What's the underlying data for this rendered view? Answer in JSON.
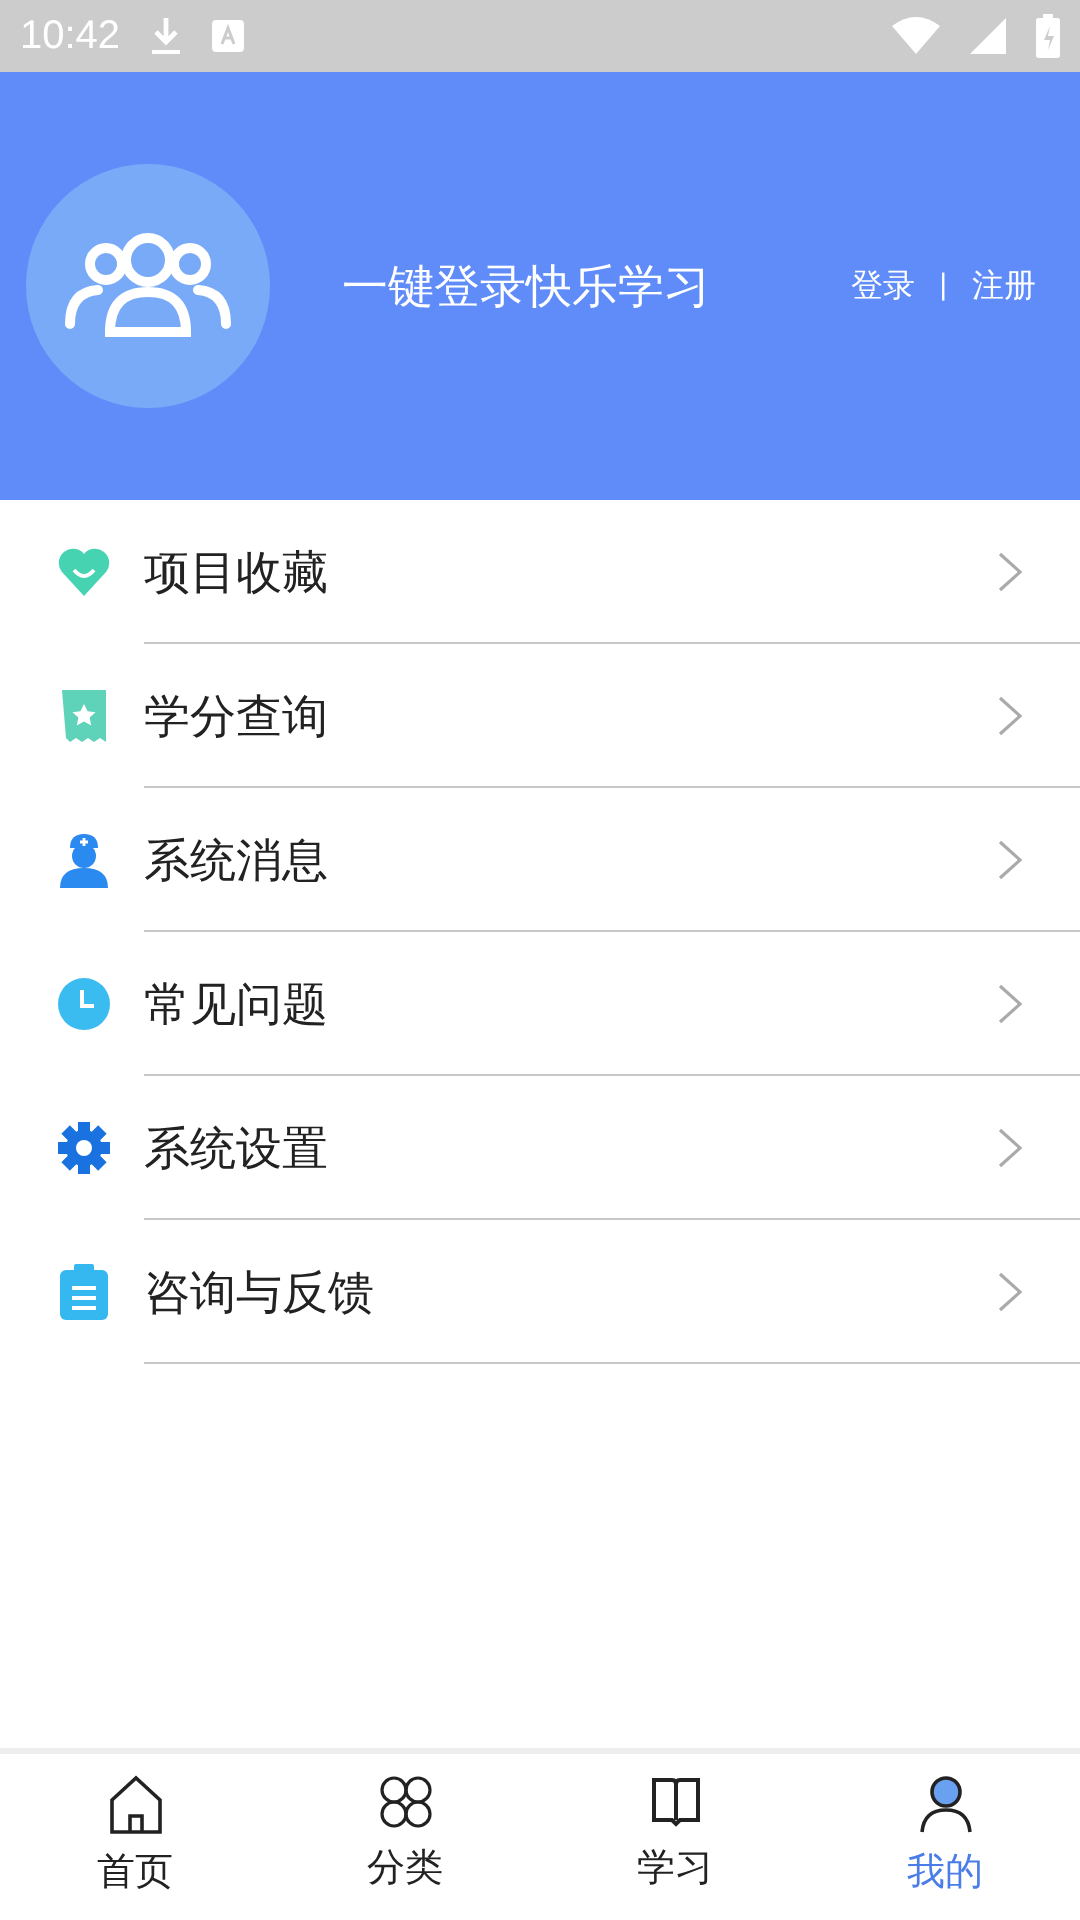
{
  "status_bar": {
    "time": "10:42"
  },
  "header": {
    "title": "一键登录快乐学习",
    "login": "登录",
    "separator": "|",
    "register": "注册"
  },
  "menu": [
    {
      "label": "项目收藏",
      "kind": "heart"
    },
    {
      "label": "学分查询",
      "kind": "ticket"
    },
    {
      "label": "系统消息",
      "kind": "nurse"
    },
    {
      "label": "常见问题",
      "kind": "clock"
    },
    {
      "label": "系统设置",
      "kind": "gear"
    },
    {
      "label": "咨询与反馈",
      "kind": "clipboard"
    }
  ],
  "tabs": [
    {
      "label": "首页",
      "kind": "home",
      "selected": false
    },
    {
      "label": "分类",
      "kind": "grid",
      "selected": false
    },
    {
      "label": "学习",
      "kind": "book",
      "selected": false
    },
    {
      "label": "我的",
      "kind": "person",
      "selected": true
    }
  ]
}
